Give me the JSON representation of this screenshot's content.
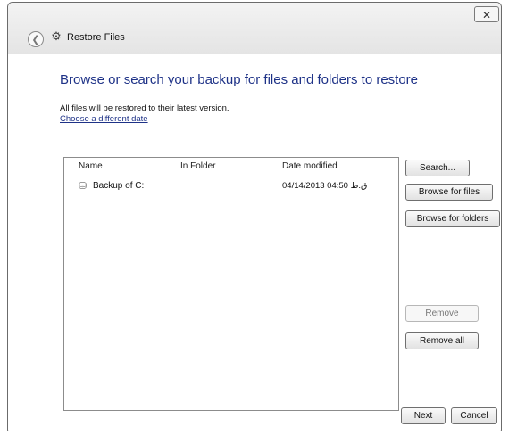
{
  "window": {
    "title": "Restore Files",
    "close_glyph": "✕",
    "back_glyph": "❮"
  },
  "icons": {
    "back": "back-arrow-icon",
    "app": "restore-files-icon",
    "drive": "backup-drive-icon"
  },
  "main": {
    "heading": "Browse or search your backup for files and folders to restore",
    "info": "All files will be restored to their latest version.",
    "link": "Choose a different date"
  },
  "file_list": {
    "columns": [
      "Name",
      "In Folder",
      "Date modified"
    ],
    "rows": [
      {
        "name": "Backup of C:",
        "folder": "",
        "date": "04/14/2013 04:50 ق.ظ"
      }
    ]
  },
  "buttons": {
    "search": "Search...",
    "browse_files": "Browse for files",
    "browse_folders": "Browse for folders",
    "remove": "Remove",
    "remove_all": "Remove all",
    "next": "Next",
    "cancel": "Cancel"
  }
}
